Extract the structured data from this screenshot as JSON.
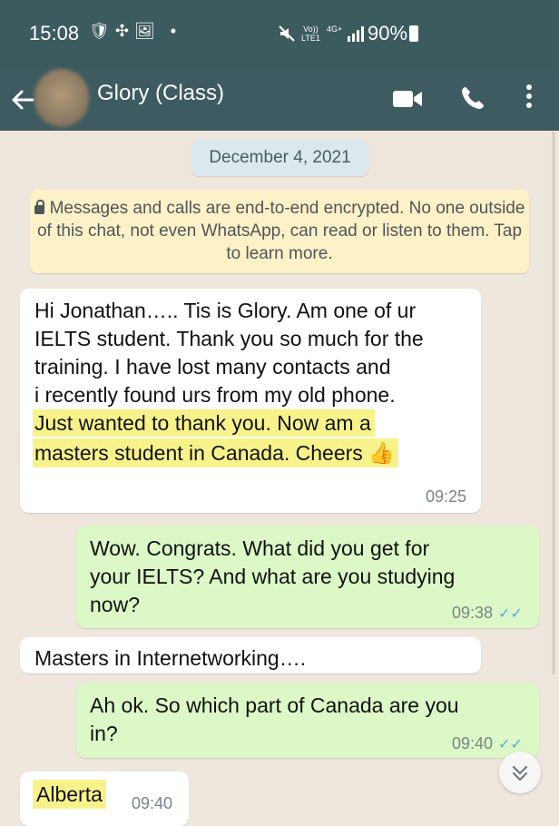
{
  "status_bar": {
    "time": "15:08",
    "notif_icons": "🛡✣🖼 •",
    "network_top": "Vo))",
    "network_bottom": "LTE1",
    "network_gen": "4G+",
    "battery_pct": "90%"
  },
  "app_bar": {
    "back_icon": "arrow-left",
    "title": "Glory (Class)",
    "video_icon": "video-camera",
    "call_icon": "phone",
    "menu_icon": "vertical-dots"
  },
  "chat": {
    "date": "December 4, 2021",
    "encryption_notice": "Messages and calls are end-to-end encrypted. No one outside of this chat, not even WhatsApp, can read or listen to them. Tap to learn more.",
    "messages": [
      {
        "lines": [
          "Hi Jonathan….. Tis is Glory. Am one of ur",
          "IELTS student. Thank you so much for the",
          "training. I have lost many contacts and",
          "i recently found urs from my old phone."
        ],
        "highlight_lines": [
          "Just wanted to thank you. Now am a",
          "masters student in Canada. Cheers"
        ],
        "emoji": "👍",
        "time": "09:25"
      },
      {
        "lines": [
          "Wow. Congrats. What did you get for",
          "your IELTS? And what are you studying",
          "now?"
        ],
        "time": "09:38",
        "ticks": "✓✓"
      },
      {
        "lines": [
          "Masters in Internetworking…."
        ]
      },
      {
        "lines": [
          "Ah ok. So which part of Canada are you",
          "in?"
        ],
        "time": "09:40",
        "ticks": "✓✓"
      },
      {
        "highlight_text": "Alberta",
        "time": "09:40"
      }
    ],
    "scroll_down_icon": "double-chevron-down"
  },
  "colors": {
    "header": "#3d5b60",
    "chat_bg": "#efe7de",
    "out_bubble": "#dcf8c6",
    "highlight": "#f7f38a",
    "tick_blue": "#4fa6e8"
  }
}
